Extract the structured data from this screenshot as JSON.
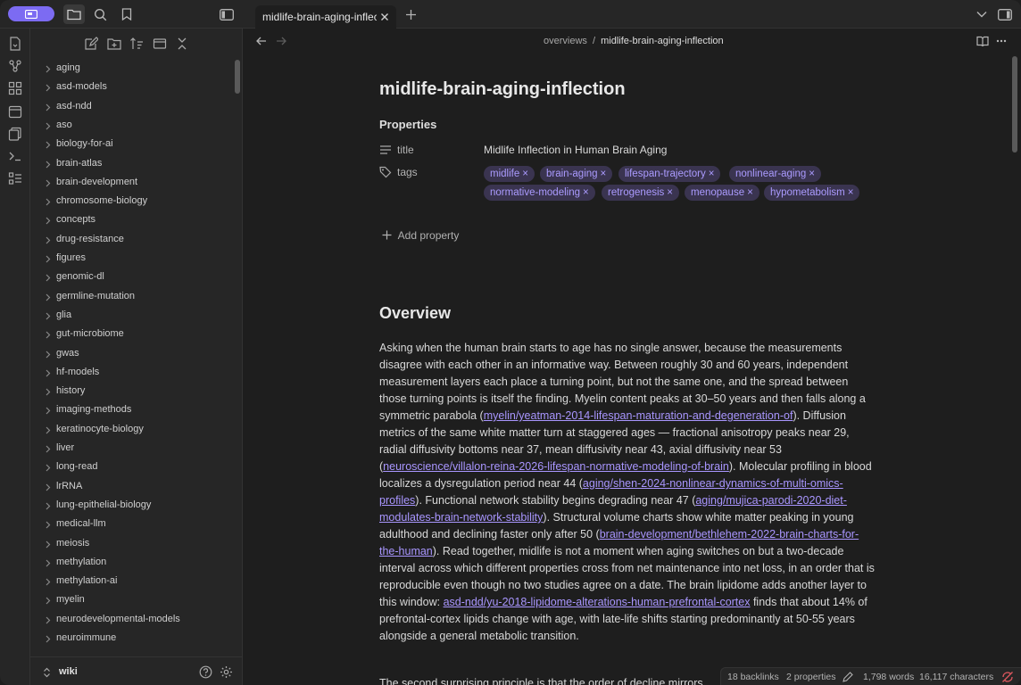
{
  "tab": {
    "title": "midlife-brain-aging-inflection"
  },
  "breadcrumb": {
    "folder": "overviews",
    "sep": "/",
    "current": "midlife-brain-aging-inflection"
  },
  "sidebar": {
    "items": [
      "aging",
      "asd-models",
      "asd-ndd",
      "aso",
      "biology-for-ai",
      "brain-atlas",
      "brain-development",
      "chromosome-biology",
      "concepts",
      "drug-resistance",
      "figures",
      "genomic-dl",
      "germline-mutation",
      "glia",
      "gut-microbiome",
      "gwas",
      "hf-models",
      "history",
      "imaging-methods",
      "keratinocyte-biology",
      "liver",
      "long-read",
      "lrRNA",
      "lung-epithelial-biology",
      "medical-llm",
      "meiosis",
      "methylation",
      "methylation-ai",
      "myelin",
      "neurodevelopmental-models",
      "neuroimmune"
    ],
    "vault_name": "wiki"
  },
  "note": {
    "title": "midlife-brain-aging-inflection",
    "properties_heading": "Properties",
    "title_key": "title",
    "title_value": "Midlife Inflection in Human Brain Aging",
    "tags_key": "tags",
    "tags": [
      "midlife",
      "brain-aging",
      "lifespan-trajectory",
      "nonlinear-aging",
      "normative-modeling",
      "retrogenesis",
      "menopause",
      "hypometabolism"
    ],
    "add_property": "Add property",
    "overview_heading": "Overview",
    "para": {
      "t1": "Asking when the human brain starts to age has no single answer, because the measurements disagree with each other in an informative way. Between roughly 30 and 60 years, independent measurement layers each place a turning point, but not the same one, and the spread between those turning points is itself the finding. Myelin content peaks at 30–50 years and then falls along a symmetric parabola (",
      "l1": "myelin/yeatman-2014-lifespan-maturation-and-degeneration-of",
      "t2": "). Diffusion metrics of the same white matter turn at staggered ages — fractional anisotropy peaks near 29, radial diffusivity bottoms near 37, mean diffusivity near 43, axial diffusivity near 53 (",
      "l2": "neuroscience/villalon-reina-2026-lifespan-normative-modeling-of-brain",
      "t3": "). Molecular profiling in blood localizes a dysregulation period near 44 (",
      "l3": "aging/shen-2024-nonlinear-dynamics-of-multi-omics-profiles",
      "t4": "). Functional network stability begins degrading near 47 (",
      "l4": "aging/mujica-parodi-2020-diet-modulates-brain-network-stability",
      "t5": "). Structural volume charts show white matter peaking in young adulthood and declining faster only after 50 (",
      "l5": "brain-development/bethlehem-2022-brain-charts-for-the-human",
      "t6": "). Read together, midlife is not a moment when aging switches on but a two-decade interval across which different properties cross from net maintenance into net loss, in an order that is reproducible even though no two studies agree on a date. The brain lipidome adds another layer to this window: ",
      "l6": "asd-ndd/yu-2018-lipidome-alterations-human-prefrontal-cortex",
      "t7": " finds that about 14% of prefrontal-cortex lipids change with age, with late-life shifts starting predominantly at 50-55 years alongside a general metabolic transition."
    },
    "para2": "The second surprising principle is that the order of decline mirrors"
  },
  "status": {
    "backlinks": "18 backlinks",
    "properties": "2 properties",
    "words": "1,798 words",
    "characters": "16,117 characters"
  },
  "colors": {
    "accent": "#7c6bf2",
    "tag_bg": "#3a3450",
    "tag_fg": "#ab9bff",
    "link": "#a996ff"
  }
}
